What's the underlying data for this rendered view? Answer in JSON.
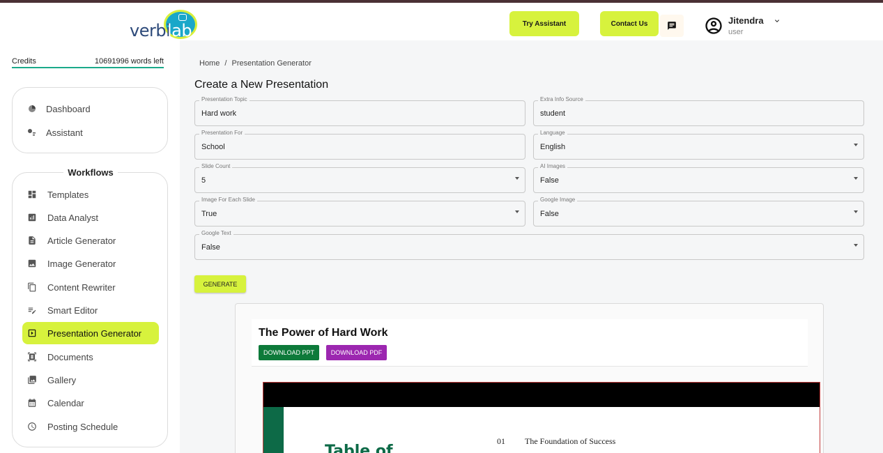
{
  "header": {
    "logo": {
      "text_left": "verbi",
      "text_right": "lab"
    },
    "try_assistant_label": "Try Assistant",
    "contact_us_label": "Contact Us",
    "user": {
      "name": "Jitendra",
      "role": "user"
    }
  },
  "sidebar": {
    "credits_label": "Credits",
    "credits_value": "10691996 words left",
    "top_items": [
      {
        "label": "Dashboard",
        "icon": "pie-chart-icon"
      },
      {
        "label": "Assistant",
        "icon": "assistant-icon"
      }
    ],
    "workflows_title": "Workflows",
    "workflow_items": [
      {
        "label": "Templates",
        "icon": "dashboard-icon"
      },
      {
        "label": "Data Analyst",
        "icon": "analytics-icon"
      },
      {
        "label": "Article Generator",
        "icon": "article-icon"
      },
      {
        "label": "Image Generator",
        "icon": "image-icon"
      },
      {
        "label": "Content Rewriter",
        "icon": "copy-icon"
      },
      {
        "label": "Smart Editor",
        "icon": "edit-note-icon"
      },
      {
        "label": "Presentation Generator",
        "icon": "slideshow-icon",
        "active": true
      },
      {
        "label": "Documents",
        "icon": "document-scanner-icon"
      },
      {
        "label": "Gallery",
        "icon": "gallery-icon"
      },
      {
        "label": "Calendar",
        "icon": "calendar-icon"
      },
      {
        "label": "Posting Schedule",
        "icon": "clock-icon"
      }
    ]
  },
  "main": {
    "breadcrumb": {
      "home": "Home",
      "separator": "/",
      "current": "Presentation Generator"
    },
    "title": "Create a New Presentation",
    "fields": {
      "presentation_topic": {
        "label": "Presentation Topic",
        "value": "Hard work"
      },
      "extra_info_source": {
        "label": "Extra Info Source",
        "value": "student"
      },
      "presentation_for": {
        "label": "Presentation For",
        "value": "School"
      },
      "language": {
        "label": "Language",
        "value": "English"
      },
      "slide_count": {
        "label": "Slide Count",
        "value": "5"
      },
      "ai_images": {
        "label": "AI Images",
        "value": "False"
      },
      "image_for_each_slide": {
        "label": "Image For Each Slide",
        "value": "True"
      },
      "google_image": {
        "label": "Google Image",
        "value": "False"
      },
      "google_text": {
        "label": "Google Text",
        "value": "False"
      }
    },
    "generate_label": "GENERATE",
    "preview": {
      "title": "The Power of Hard Work",
      "download_ppt_label": "DOWNLOAD PPT",
      "download_pdf_label": "DOWNLOAD PDF",
      "slide": {
        "heading": "Table of",
        "item_number": "01",
        "item_text": "The Foundation of Success"
      }
    }
  },
  "colors": {
    "accent_lime": "#d7f23d",
    "brand_blue": "#1aa7c9",
    "ppt_green": "#0d7a3a",
    "pdf_purple": "#9c27b0",
    "slide_green": "#0d6a47",
    "credits_underline": "#1aa98a"
  }
}
